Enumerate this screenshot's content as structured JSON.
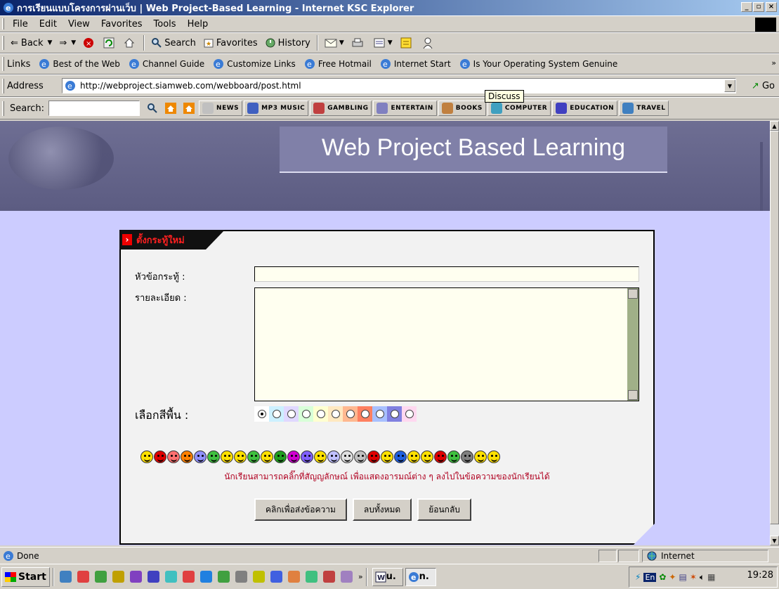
{
  "window": {
    "title": "การเรียนแบบโครงการผ่านเว็บ | Web Project-Based Learning - Internet KSC Explorer"
  },
  "menu": [
    "File",
    "Edit",
    "View",
    "Favorites",
    "Tools",
    "Help"
  ],
  "toolbar": {
    "back": "Back",
    "search": "Search",
    "favorites": "Favorites",
    "history": "History"
  },
  "links": {
    "label": "Links",
    "items": [
      "Best of the Web",
      "Channel Guide",
      "Customize Links",
      "Free Hotmail",
      "Internet Start",
      "Is Your Operating System Genuine"
    ],
    "tooltip": "Discuss"
  },
  "address": {
    "label": "Address",
    "url": "http://webproject.siamweb.com/webboard/post.html",
    "go": "Go"
  },
  "searchbar": {
    "label": "Search:",
    "buttons": [
      {
        "label": "NEWS",
        "icon": "news-icon",
        "color": "#c0c0c0"
      },
      {
        "label": "MP3 MUSIC",
        "icon": "music-icon",
        "color": "#4060c0"
      },
      {
        "label": "GAMBLING",
        "icon": "dice-icon",
        "color": "#c04040"
      },
      {
        "label": "ENTERTAIN",
        "icon": "film-icon",
        "color": "#8080c0"
      },
      {
        "label": "BOOKS",
        "icon": "books-icon",
        "color": "#c08040"
      },
      {
        "label": "COMPUTER",
        "icon": "computer-icon",
        "color": "#40a0c0"
      },
      {
        "label": "EDUCATION",
        "icon": "education-icon",
        "color": "#4040c0"
      },
      {
        "label": "TRAVEL",
        "icon": "globe-icon",
        "color": "#4080c0"
      }
    ]
  },
  "page": {
    "banner_title": "Web Project Based Learning",
    "form_tag": "ตั้งกระทู้ใหม่",
    "subject_label": "หัวข้อกระทู้ :",
    "subject_value": "",
    "detail_label": "รายละเอียด :",
    "detail_value": "",
    "bg_label": "เลือกสีพื้น :",
    "bg_colors": [
      "#ffffff",
      "#ccf0ff",
      "#e0d8ff",
      "#d8ffd8",
      "#ffffd0",
      "#ffe8c0",
      "#ffb890",
      "#ff8060",
      "#a8c0ff",
      "#8080e0",
      "#ffd8f0"
    ],
    "selected_color_index": 0,
    "emoji_colors": [
      "#ffe000",
      "#e00000",
      "#ff7070",
      "#ff8000",
      "#9090ff",
      "#40c040",
      "#ffe000",
      "#ffe000",
      "#40c040",
      "#ffe000",
      "#20a020",
      "#d000d0",
      "#8060ff",
      "#ffe000",
      "#c0c0ff",
      "#e0e0e0",
      "#c0c0c0",
      "#e00000",
      "#ffe000",
      "#2060e0",
      "#ffe000",
      "#ffe000",
      "#e00000",
      "#40c040",
      "#808080",
      "#ffe000",
      "#ffe000"
    ],
    "emoji_hint": "นักเรียนสามารถคลิ๊กที่สัญญลักษณ์ เพื่อแสดงอารมณ์ต่าง ๆ ลงไปในข้อความของนักเรียนได้",
    "buttons": {
      "submit": "คลิกเพื่อส่งข้อความ",
      "clear": "ลบทั้งหมด",
      "back": "ย้อนกลับ"
    }
  },
  "status": {
    "text": "Done",
    "zone": "Internet"
  },
  "taskbar": {
    "start": "Start",
    "tasks": [
      "u.",
      "n."
    ],
    "lang": "En",
    "clock": "19:28",
    "quick_colors": [
      "#4080c0",
      "#e04040",
      "#40a040",
      "#c0a000",
      "#8040c0",
      "#4040c0",
      "#40c0c0",
      "#e04040",
      "#2080e0",
      "#40a040",
      "#808080",
      "#c0c000",
      "#4060e0",
      "#e08040",
      "#40c080",
      "#c04040",
      "#a080c0"
    ]
  }
}
